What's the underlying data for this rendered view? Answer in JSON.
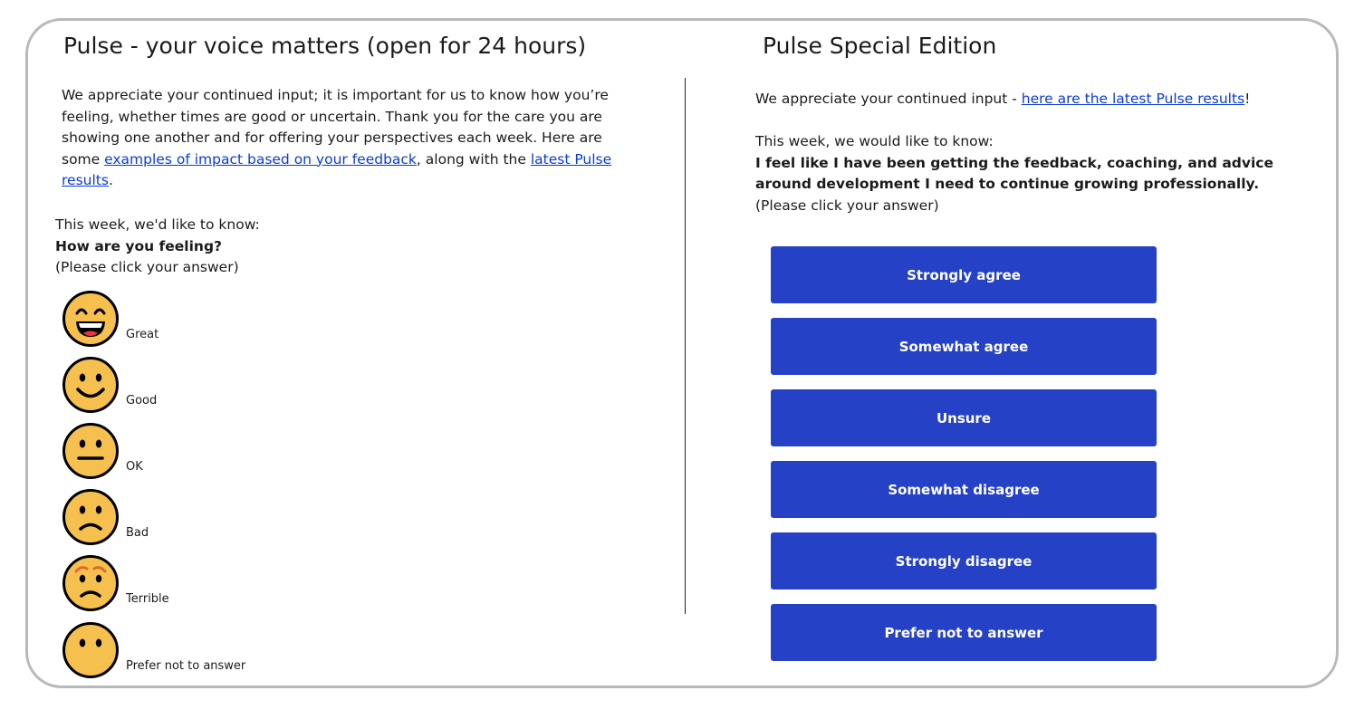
{
  "left": {
    "title": "Pulse - your voice matters (open for 24 hours)",
    "intro_pre": "We appreciate your continued input; it is important for us to know how you’re feeling, whether times are good or uncertain. Thank you for the care you are showing one another and for offering your perspectives each week. Here are some ",
    "link_impact": "examples of impact based on your feedback",
    "intro_mid": ", along with the ",
    "link_results": "latest Pulse results",
    "intro_end": ".",
    "ask": "This week, we'd like to know:",
    "question": "How are you feeling?",
    "instruction": "(Please click your answer)",
    "options": [
      {
        "label": "Great",
        "icon": "grinning-face-icon"
      },
      {
        "label": "Good",
        "icon": "smiling-face-icon"
      },
      {
        "label": "OK",
        "icon": "neutral-face-icon"
      },
      {
        "label": "Bad",
        "icon": "slightly-frowning-face-icon"
      },
      {
        "label": "Terrible",
        "icon": "worried-face-icon"
      },
      {
        "label": "Prefer not to answer",
        "icon": "face-without-mouth-icon"
      }
    ]
  },
  "right": {
    "title": "Pulse Special Edition",
    "intro_pre": "We appreciate your continued input - ",
    "link_results": "here are the latest Pulse results",
    "intro_end": "!",
    "ask": "This week, we would like to know:",
    "question": "I feel like I have been getting the feedback, coaching, and advice around development I need to continue growing professionally.",
    "instruction": "(Please click your answer)",
    "options": [
      "Strongly agree",
      "Somewhat agree",
      "Unsure",
      "Somewhat disagree",
      "Strongly disagree",
      "Prefer not to answer"
    ]
  },
  "colors": {
    "button_bg": "#2541c5",
    "link": "#0b3bd6",
    "emoji_fill": "#f5c04e",
    "frame_border": "#b9b9b9"
  }
}
